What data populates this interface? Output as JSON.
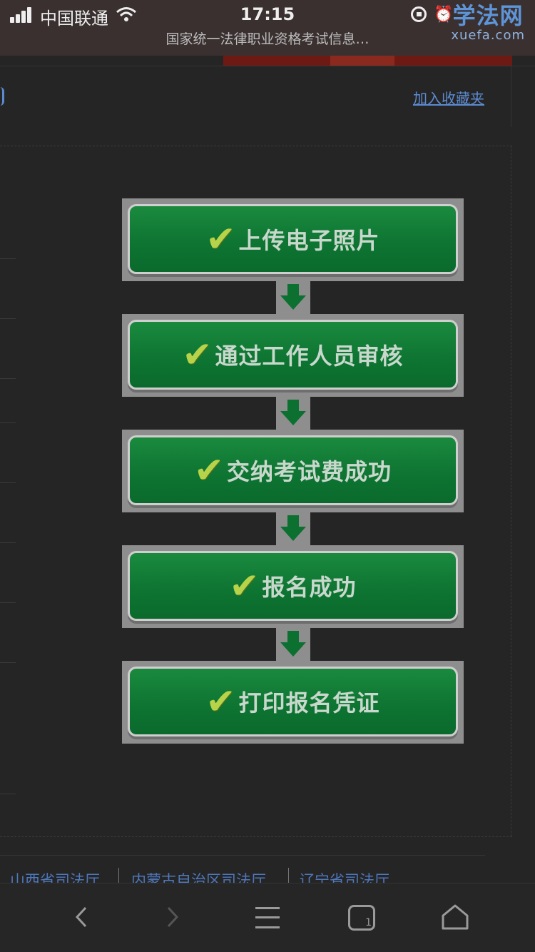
{
  "status_bar": {
    "carrier": "中国联通",
    "time": "17:15",
    "page_title": "国家统一法律职业资格考试信息…"
  },
  "logo": {
    "cn": "学法网",
    "en": "xuefa.com"
  },
  "header": {
    "bookmark_link": "加入收藏夹"
  },
  "flow": {
    "steps": [
      {
        "label": "上传电子照片"
      },
      {
        "label": "通过工作人员审核"
      },
      {
        "label": "交纳考试费成功"
      },
      {
        "label": "报名成功"
      },
      {
        "label": "打印报名凭证"
      }
    ]
  },
  "bottom_links": [
    "山西省司法厅",
    "内蒙古自治区司法厅",
    "辽宁省司法厅"
  ],
  "colors": {
    "step_green": "#0e7532",
    "check_yellow": "#b7d34a",
    "link_blue": "#5c8ad0"
  },
  "navbar": {
    "icons": [
      "back-icon",
      "forward-icon",
      "menu-icon",
      "tabs-icon",
      "home-icon"
    ]
  }
}
